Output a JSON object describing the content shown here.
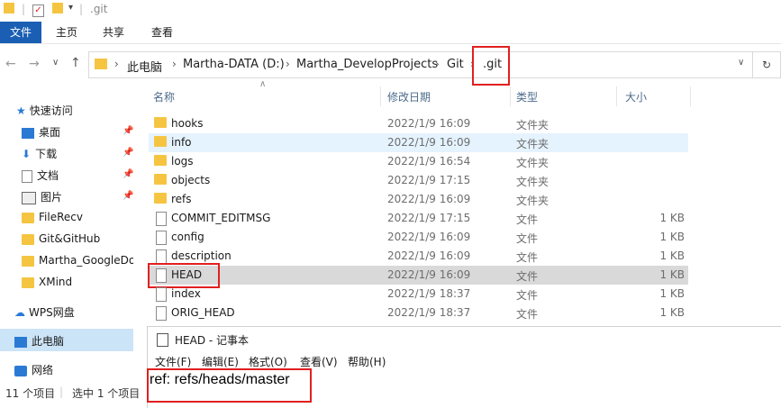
{
  "window": {
    "title": ".git"
  },
  "ribbon": {
    "tabs": [
      "文件",
      "主页",
      "共享",
      "查看"
    ]
  },
  "address": {
    "crumbs": [
      "此电脑",
      "Martha-DATA (D:)",
      "Martha_DevelopProjects",
      "Git",
      ".git"
    ]
  },
  "sidebar": {
    "quick_access": "快速访问",
    "items": [
      "桌面",
      "下载",
      "文档",
      "图片",
      "FileRecv",
      "Git&GitHub",
      "Martha_GoogleDo",
      "XMind"
    ],
    "wps": "WPS网盘",
    "this_pc": "此电脑",
    "network": "网络"
  },
  "columns": {
    "name": "名称",
    "modified": "修改日期",
    "type": "类型",
    "size": "大小"
  },
  "files": [
    {
      "name": "hooks",
      "date": "2022/1/9 16:09",
      "type": "文件夹",
      "size": "",
      "kind": "folder"
    },
    {
      "name": "info",
      "date": "2022/1/9 16:09",
      "type": "文件夹",
      "size": "",
      "kind": "folder"
    },
    {
      "name": "logs",
      "date": "2022/1/9 16:54",
      "type": "文件夹",
      "size": "",
      "kind": "folder"
    },
    {
      "name": "objects",
      "date": "2022/1/9 17:15",
      "type": "文件夹",
      "size": "",
      "kind": "folder"
    },
    {
      "name": "refs",
      "date": "2022/1/9 16:09",
      "type": "文件夹",
      "size": "",
      "kind": "folder"
    },
    {
      "name": "COMMIT_EDITMSG",
      "date": "2022/1/9 17:15",
      "type": "文件",
      "size": "1 KB",
      "kind": "file"
    },
    {
      "name": "config",
      "date": "2022/1/9 16:09",
      "type": "文件",
      "size": "1 KB",
      "kind": "file"
    },
    {
      "name": "description",
      "date": "2022/1/9 16:09",
      "type": "文件",
      "size": "1 KB",
      "kind": "file"
    },
    {
      "name": "HEAD",
      "date": "2022/1/9 16:09",
      "type": "文件",
      "size": "1 KB",
      "kind": "file"
    },
    {
      "name": "index",
      "date": "2022/1/9 18:37",
      "type": "文件",
      "size": "1 KB",
      "kind": "file"
    },
    {
      "name": "ORIG_HEAD",
      "date": "2022/1/9 18:37",
      "type": "文件",
      "size": "1 KB",
      "kind": "file"
    }
  ],
  "status": {
    "count": "11 个项目",
    "selected": "选中 1 个项目"
  },
  "notepad": {
    "title": "HEAD - 记事本",
    "menu": [
      "文件(F)",
      "编辑(E)",
      "格式(O)",
      "查看(V)",
      "帮助(H)"
    ],
    "content": "ref: refs/heads/master"
  },
  "colors": {
    "accent": "#1a5fb4",
    "highlight": "#e02020",
    "selected_row": "#d9d9d9",
    "hover_row": "#e5f3ff"
  }
}
